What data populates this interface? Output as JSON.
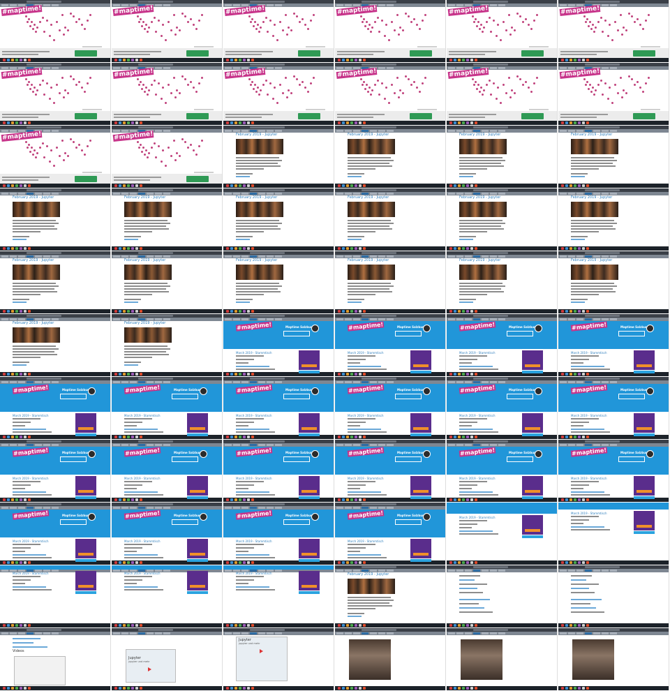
{
  "sheet": {
    "columns": 6,
    "rows": 11,
    "cell_width": 160,
    "cell_height": 90
  },
  "map_page": {
    "logo_text": "#maptime!",
    "accent": "#c7348a",
    "marker_color": "#c0427c",
    "button_color": "#2f9a55"
  },
  "post_page": {
    "title": "February 2019 - Jupyter",
    "link_color": "#2f7fbd"
  },
  "event_page": {
    "logo_text": "#maptime!",
    "site_title": "Maptime Salzburg",
    "title": "March 2019 - Stammtisch",
    "header_color": "#2196d9",
    "panel_color": "#5a2d8c",
    "button_color": "#f0902a"
  },
  "video_page": {
    "section_title": "Videos",
    "video_title": "Jupyter",
    "video_subtitle": "jupyter und mehr"
  },
  "cells": [
    {
      "type": "map"
    },
    {
      "type": "map"
    },
    {
      "type": "map"
    },
    {
      "type": "map"
    },
    {
      "type": "map"
    },
    {
      "type": "map"
    },
    {
      "type": "map"
    },
    {
      "type": "map"
    },
    {
      "type": "map"
    },
    {
      "type": "map"
    },
    {
      "type": "map"
    },
    {
      "type": "map"
    },
    {
      "type": "map"
    },
    {
      "type": "map"
    },
    {
      "type": "post"
    },
    {
      "type": "post"
    },
    {
      "type": "post"
    },
    {
      "type": "post"
    },
    {
      "type": "post"
    },
    {
      "type": "post"
    },
    {
      "type": "post"
    },
    {
      "type": "post"
    },
    {
      "type": "post"
    },
    {
      "type": "post"
    },
    {
      "type": "post"
    },
    {
      "type": "post"
    },
    {
      "type": "post"
    },
    {
      "type": "post"
    },
    {
      "type": "post"
    },
    {
      "type": "post"
    },
    {
      "type": "post"
    },
    {
      "type": "post"
    },
    {
      "type": "event"
    },
    {
      "type": "event"
    },
    {
      "type": "event"
    },
    {
      "type": "event"
    },
    {
      "type": "event"
    },
    {
      "type": "event"
    },
    {
      "type": "event"
    },
    {
      "type": "event"
    },
    {
      "type": "event"
    },
    {
      "type": "event"
    },
    {
      "type": "event"
    },
    {
      "type": "event"
    },
    {
      "type": "event"
    },
    {
      "type": "event"
    },
    {
      "type": "event"
    },
    {
      "type": "event"
    },
    {
      "type": "event"
    },
    {
      "type": "event"
    },
    {
      "type": "event"
    },
    {
      "type": "event"
    },
    {
      "type": "event-scroll"
    },
    {
      "type": "event-scroll2"
    },
    {
      "type": "event-low"
    },
    {
      "type": "event-low"
    },
    {
      "type": "event-low"
    },
    {
      "type": "post-photo"
    },
    {
      "type": "list"
    },
    {
      "type": "list"
    },
    {
      "type": "list-videos"
    },
    {
      "type": "video"
    },
    {
      "type": "video2"
    },
    {
      "type": "photo"
    },
    {
      "type": "photo"
    },
    {
      "type": "photo"
    }
  ]
}
